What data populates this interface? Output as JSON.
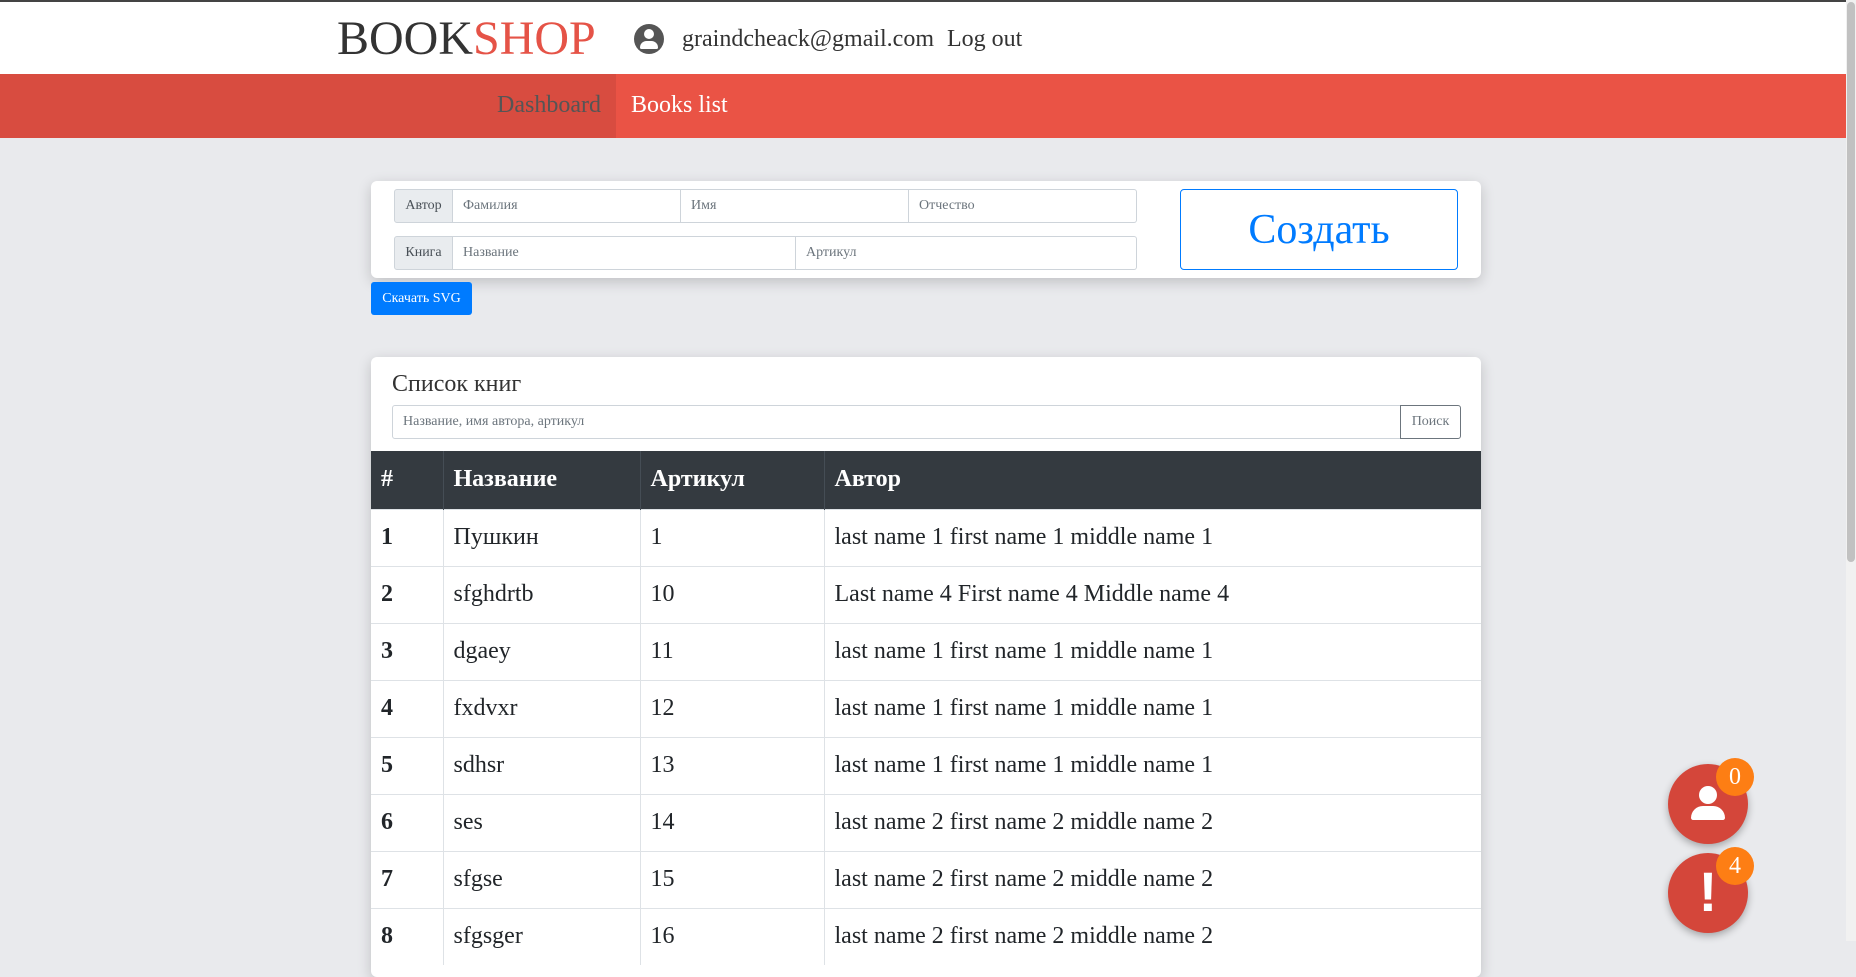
{
  "header": {
    "logo_part1": "BOOK",
    "logo_part2": "SHOP",
    "email": "graindcheack@gmail.com",
    "logout": "Log out"
  },
  "nav": {
    "dashboard": "Dashboard",
    "books_list": "Books list"
  },
  "form": {
    "author_label": "Автор",
    "lastname_placeholder": "Фамилия",
    "firstname_placeholder": "Имя",
    "middlename_placeholder": "Отчество",
    "book_label": "Книга",
    "title_placeholder": "Название",
    "article_placeholder": "Артикул",
    "create_button": "Создать",
    "download_svg": "Скачать SVG"
  },
  "list": {
    "title": "Список книг",
    "search_placeholder": "Название, имя автора, артикул",
    "search_button": "Поиск",
    "columns": [
      "#",
      "Название",
      "Артикул",
      "Автор"
    ],
    "rows": [
      [
        "1",
        "Пушкин",
        "1",
        "last name 1 first name 1 middle name 1"
      ],
      [
        "2",
        "sfghdrtb",
        "10",
        "Last name 4 First name 4 Middle name 4"
      ],
      [
        "3",
        "dgaey",
        "11",
        "last name 1 first name 1 middle name 1"
      ],
      [
        "4",
        "fxdvxr",
        "12",
        "last name 1 first name 1 middle name 1"
      ],
      [
        "5",
        "sdhsr",
        "13",
        "last name 1 first name 1 middle name 1"
      ],
      [
        "6",
        "ses",
        "14",
        "last name 2 first name 2 middle name 2"
      ],
      [
        "7",
        "sfgse",
        "15",
        "last name 2 first name 2 middle name 2"
      ],
      [
        "8",
        "sfgsger",
        "16",
        "last name 2 first name 2 middle name 2"
      ]
    ]
  },
  "fabs": {
    "user_badge": "0",
    "alert_badge": "4",
    "alert_symbol": "!"
  },
  "colors": {
    "brand_red": "#ea5345",
    "primary_blue": "#007bff",
    "table_header": "#343a40",
    "badge_orange": "#fd7e14"
  }
}
